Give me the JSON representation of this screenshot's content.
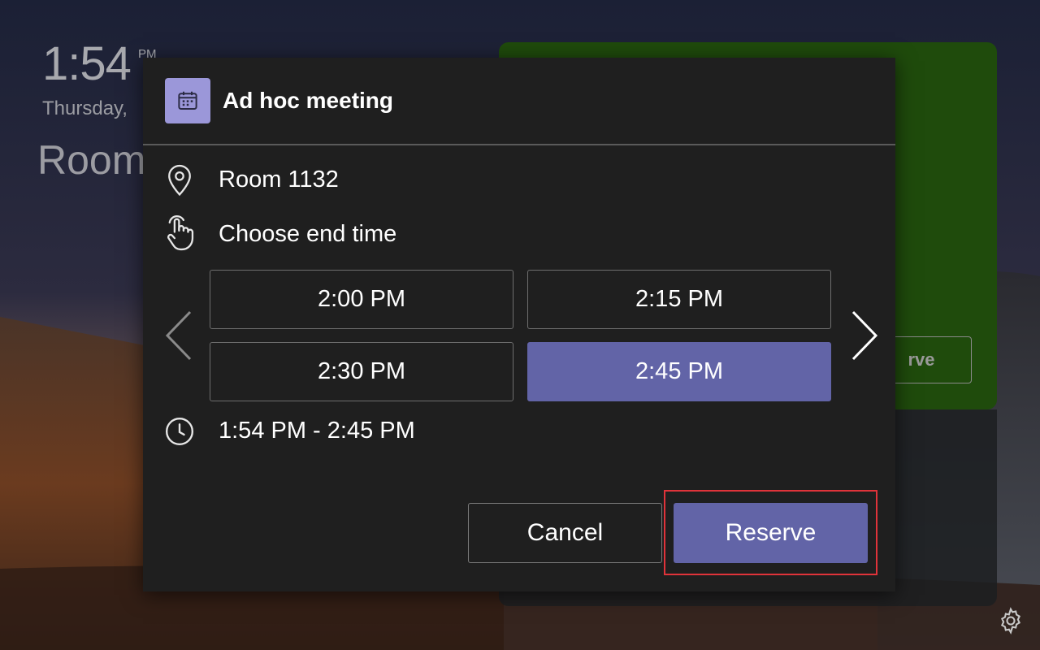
{
  "background": {
    "clock_time": "1:54",
    "clock_ampm": "PM",
    "date": "Thursday,",
    "room": "Room",
    "status_panel_color": "#1f4b0c",
    "reserve_button_partial": "rve"
  },
  "dialog": {
    "title": "Ad hoc meeting",
    "title_icon": "calendar-icon",
    "location_icon": "location-pin-icon",
    "location": "Room 1132",
    "instruction_icon": "touch-hand-icon",
    "instruction": "Choose end time",
    "time_slots": [
      {
        "label": "2:00 PM",
        "selected": false
      },
      {
        "label": "2:15 PM",
        "selected": false
      },
      {
        "label": "2:30 PM",
        "selected": false
      },
      {
        "label": "2:45 PM",
        "selected": true
      }
    ],
    "prev_icon": "chevron-left-icon",
    "next_icon": "chevron-right-icon",
    "duration_icon": "clock-icon",
    "duration": "1:54 PM - 2:45 PM",
    "cancel_label": "Cancel",
    "reserve_label": "Reserve"
  },
  "settings_icon": "gear-icon",
  "colors": {
    "accent": "#6264a7",
    "dialog_bg": "#1f1f1f",
    "highlight": "#e0333a"
  }
}
